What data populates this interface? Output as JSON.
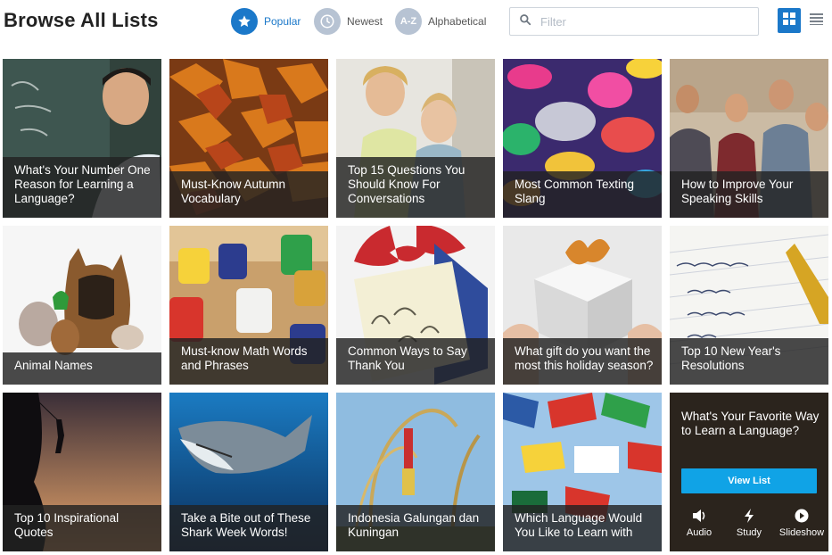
{
  "header": {
    "title": "Browse All Lists",
    "sort_options": [
      {
        "label": "Popular",
        "icon": "star-icon",
        "active": true
      },
      {
        "label": "Newest",
        "icon": "clock-icon",
        "active": false
      },
      {
        "label": "Alphabetical",
        "icon": "az-icon",
        "badge": "A-Z",
        "active": false
      }
    ],
    "filter": {
      "placeholder": "Filter",
      "value": ""
    },
    "view_modes": [
      {
        "name": "grid-view",
        "icon": "grid-icon",
        "active": true
      },
      {
        "name": "list-view",
        "icon": "list-icon",
        "active": false
      }
    ]
  },
  "colors": {
    "accent": "#1b78c9",
    "cta_button": "#10a3e6",
    "caption_bg": "#222222"
  },
  "lists": [
    {
      "title": "What's Your Number One Reason for Learning a Language?",
      "image": "chalkboard-student-photo"
    },
    {
      "title": "Must-Know Autumn Vocabulary",
      "image": "autumn-leaves-photo"
    },
    {
      "title": "Top 15 Questions You Should Know For Conversations",
      "image": "mother-son-photo"
    },
    {
      "title": "Most Common Texting Slang",
      "image": "speech-bubbles-illustration"
    },
    {
      "title": "How to Improve Your Speaking Skills",
      "image": "friends-cafe-photo"
    },
    {
      "title": "Animal Names",
      "image": "pets-group-photo"
    },
    {
      "title": "Must-know Math Words and Phrases",
      "image": "number-blocks-photo"
    },
    {
      "title": "Common Ways to Say Thank You",
      "image": "thank-you-gift-photo"
    },
    {
      "title": "What gift do you want the most this holiday season?",
      "image": "gift-box-photo"
    },
    {
      "title": "Top 10 New Year's Resolutions",
      "image": "resolutions-notepad-photo"
    },
    {
      "title": "Top 10 Inspirational Quotes",
      "image": "cliff-climber-photo"
    },
    {
      "title": "Take a Bite out of These Shark Week Words!",
      "image": "shark-photo"
    },
    {
      "title": "Indonesia Galungan dan Kuningan",
      "image": "penjor-decorations-photo"
    },
    {
      "title": "Which Language Would You Like to Learn with",
      "image": "world-flags-photo"
    }
  ],
  "cta": {
    "title": "What's Your Favorite Way to Learn a Language?",
    "button": "View List",
    "modes": [
      {
        "label": "Audio",
        "icon": "speaker-icon"
      },
      {
        "label": "Study",
        "icon": "lightning-icon"
      },
      {
        "label": "Slideshow",
        "icon": "play-icon"
      }
    ]
  }
}
